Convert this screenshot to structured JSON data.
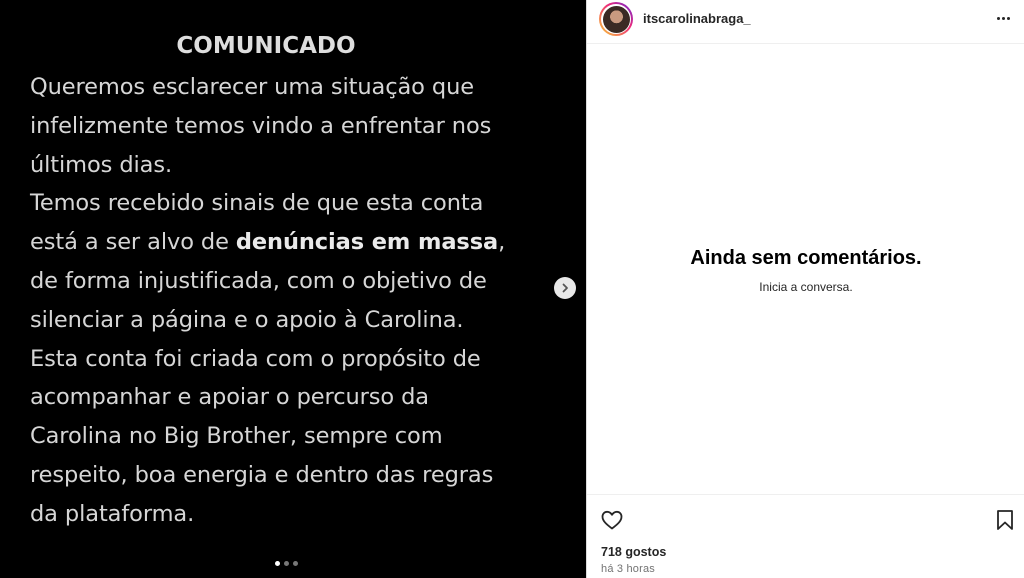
{
  "post": {
    "title": "COMUNICADO",
    "lines": [
      "Queremos esclarecer uma situação que",
      "infelizmente temos vindo a enfrentar nos",
      "últimos dias.",
      "Temos recebido sinais de que esta conta",
      "está a ser alvo de ",
      "denúncias em massa",
      ",",
      "de forma injustificada, com o objetivo de",
      "silenciar a página e o apoio à Carolina.",
      "Esta conta foi criada com o propósito de",
      "acompanhar e apoiar o percurso da",
      "Carolina no Big Brother, sempre com",
      "respeito, boa energia e dentro das regras",
      "da plataforma."
    ],
    "carousel": {
      "total": 3,
      "active": 1
    }
  },
  "header": {
    "username": "itscarolinabraga_"
  },
  "comments": {
    "empty_title": "Ainda sem comentários.",
    "empty_subtitle": "Inicia a conversa."
  },
  "footer": {
    "likes": "718 gostos",
    "timestamp": "há 3 horas"
  },
  "icons": {
    "next": "chevron-right-icon",
    "like": "heart-icon",
    "save": "bookmark-icon",
    "more": "more-horizontal-icon"
  },
  "colors": {
    "media_background": "#000000",
    "text_primary": "#262626",
    "text_secondary": "#737373",
    "story_ring_start": "#f9ce34",
    "story_ring_end": "#6228d7"
  }
}
